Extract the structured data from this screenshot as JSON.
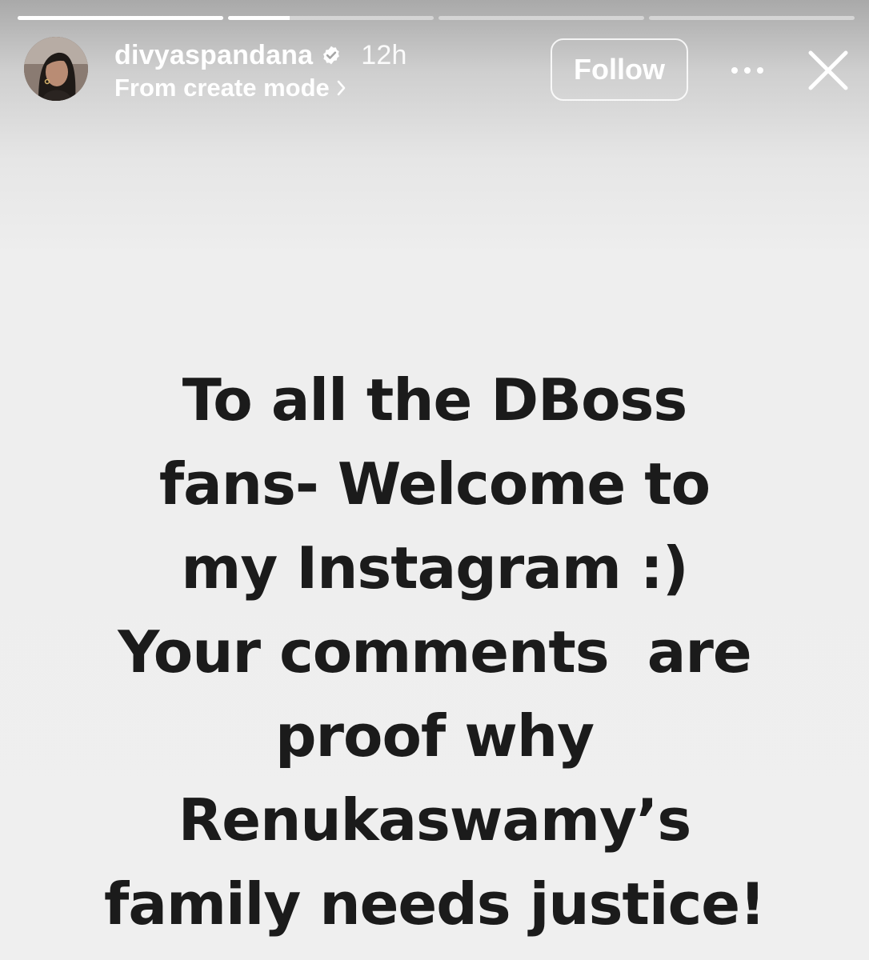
{
  "progress": {
    "segments": [
      {
        "fill": 1.0
      },
      {
        "fill": 0.3
      },
      {
        "fill": 0.0
      },
      {
        "fill": 0.0
      }
    ]
  },
  "header": {
    "username": "divyaspandana",
    "verified": true,
    "time": "12h",
    "subline": "From create mode",
    "follow_label": "Follow",
    "more_icon": "more-horizontal-icon",
    "close_icon": "close-icon"
  },
  "story": {
    "lines": [
      "To all the DBoss",
      "fans- Welcome to",
      "my Instagram :)",
      "Your comments  are",
      "proof why",
      "Renukaswamy’s",
      "family needs justice!"
    ]
  },
  "colors": {
    "text": "#1b1b1b",
    "background": "#efefef",
    "header_text": "#ffffff"
  }
}
